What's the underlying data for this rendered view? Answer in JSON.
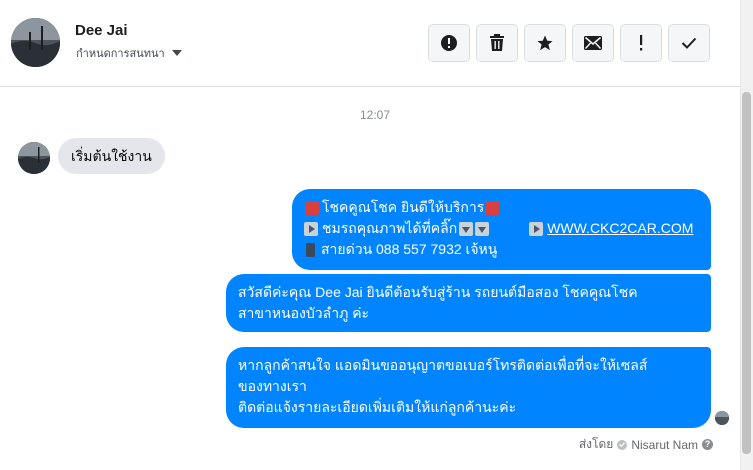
{
  "header": {
    "name": "Dee Jai",
    "subtitle": "กำหนดการสนทนา",
    "actions": [
      {
        "icon": "alert-circle-icon",
        "glyph": "!"
      },
      {
        "icon": "trash-icon"
      },
      {
        "icon": "star-icon"
      },
      {
        "icon": "envelope-icon"
      },
      {
        "icon": "exclamation-icon",
        "glyph": "!"
      },
      {
        "icon": "checkmark-icon"
      }
    ]
  },
  "thread": {
    "timestamp": "12:07",
    "incoming": [
      {
        "text": "เริ่มต้นใช้งาน"
      }
    ],
    "outgoing": {
      "msg1": {
        "line1": "โชคคูณโชค ยินดีให้บริการ",
        "line2": "ชมรถคุณภาพได้ที่คลิ๊ก",
        "link": "WWW.CKC2CAR.COM",
        "line3": "สายด่วน 088 557 7932 เจ้หนู"
      },
      "msg2": {
        "line1": "สวัสดีค่ะคุณ Dee Jai ยินดีต้อนรับสู่ร้าน รถยนต์มือสอง โชคคูณโชค",
        "line2": "สาขาหนองบัวลำภู ค่ะ"
      },
      "msg3": {
        "line1": "หากลูกค้าสนใจ แอดมินขออนุญาตขอเบอร์โทรติดต่อเพื่อที่จะให้เซลส์",
        "line2": "ของทางเรา",
        "line3": "ติดต่อแจ้งรายละเอียดเพิ่มเติมให้แก่ลูกค้านะค่ะ"
      }
    },
    "sent_by_label": "ส่งโดย",
    "sent_by_name": "Nisarut Nam"
  },
  "colors": {
    "outgoing_bubble": "#0084ff",
    "incoming_bubble": "#e4e6eb"
  }
}
